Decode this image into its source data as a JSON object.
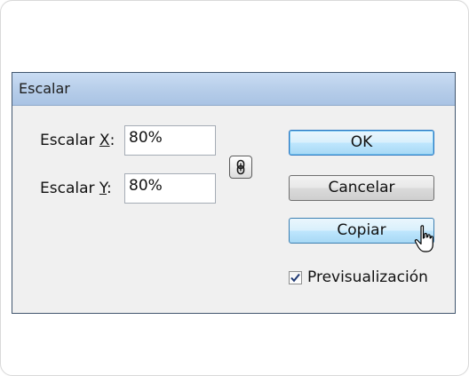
{
  "dialog": {
    "title": "Escalar"
  },
  "fields": {
    "x": {
      "label_prefix": "Escalar ",
      "label_key": "X",
      "label_suffix": ":",
      "value": "80%"
    },
    "y": {
      "label_prefix": "Escalar ",
      "label_key": "Y",
      "label_suffix": ":",
      "value": "80%"
    }
  },
  "link_icon": {
    "name": "link-proportions-icon",
    "state": "linked"
  },
  "buttons": {
    "ok": "OK",
    "cancel": "Cancelar",
    "copy": "Copiar"
  },
  "preview": {
    "label": "Previsualización",
    "checked": true
  },
  "colors": {
    "title_bar": "#b6cde9",
    "dialog_body": "#f0f0f0",
    "dialog_border": "#41566e",
    "accent_blue": "#2d76c0"
  }
}
